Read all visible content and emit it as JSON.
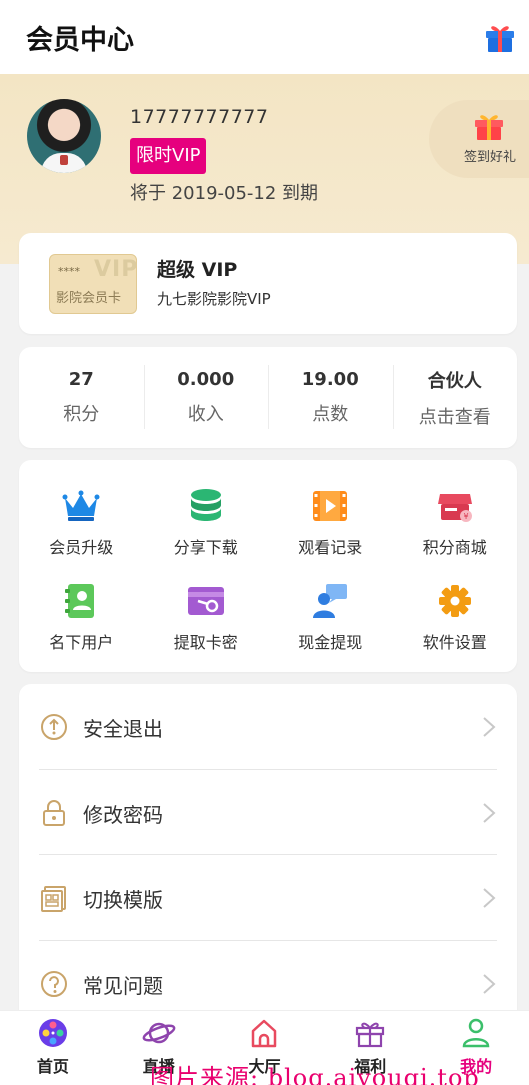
{
  "header": {
    "title": "会员中心"
  },
  "profile": {
    "phone": "17777777777",
    "vip_badge": "限时VIP",
    "expire_text": "将于 2019-05-12 到期",
    "signin_label": "签到好礼"
  },
  "vip_card": {
    "ticket_stars": "****",
    "ticket_vip": "VIP",
    "ticket_label": "影院会员卡",
    "name": "超级 VIP",
    "desc": "九七影院影院VIP"
  },
  "stats": [
    {
      "value": "27",
      "label": "积分"
    },
    {
      "value": "0.000",
      "label": "收入"
    },
    {
      "value": "19.00",
      "label": "点数"
    },
    {
      "value": "合伙人",
      "label": "点击查看"
    }
  ],
  "grid": [
    {
      "label": "会员升级",
      "icon": "crown-icon",
      "color": "#1e88e5"
    },
    {
      "label": "分享下载",
      "icon": "database-icon",
      "color": "#2bb673"
    },
    {
      "label": "观看记录",
      "icon": "film-icon",
      "color": "#ff8c1a"
    },
    {
      "label": "积分商城",
      "icon": "shop-icon",
      "color": "#e84a5f"
    },
    {
      "label": "名下用户",
      "icon": "contacts-icon",
      "color": "#5cc85a"
    },
    {
      "label": "提取卡密",
      "icon": "card-key-icon",
      "color": "#a35ad1"
    },
    {
      "label": "现金提现",
      "icon": "customer-service-icon",
      "color": "#2f7de0"
    },
    {
      "label": "软件设置",
      "icon": "gear-icon",
      "color": "#f39c12"
    }
  ],
  "menu": [
    {
      "label": "安全退出",
      "icon": "logout-icon"
    },
    {
      "label": "修改密码",
      "icon": "lock-icon"
    },
    {
      "label": "切换模版",
      "icon": "template-icon"
    },
    {
      "label": "常见问题",
      "icon": "question-icon"
    }
  ],
  "tabs": [
    {
      "label": "首页",
      "icon": "film-reel-icon",
      "active": false
    },
    {
      "label": "直播",
      "icon": "planet-icon",
      "active": false
    },
    {
      "label": "大厅",
      "icon": "house-icon",
      "active": false
    },
    {
      "label": "福利",
      "icon": "gift-icon",
      "active": false
    },
    {
      "label": "我的",
      "icon": "user-icon",
      "active": true
    }
  ],
  "watermark": "图片来源: blog.aiyouqi.top",
  "colors": {
    "accent": "#e6007e",
    "gold_bg": "#f3e5c4"
  }
}
